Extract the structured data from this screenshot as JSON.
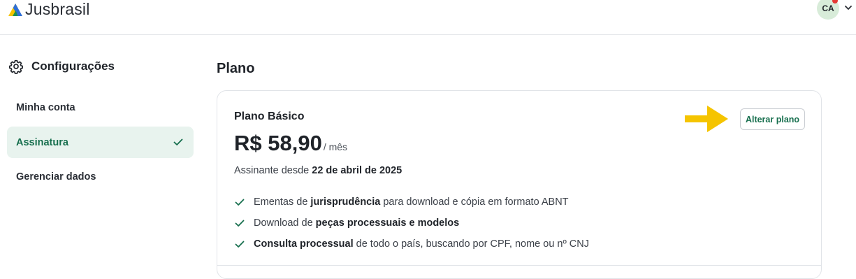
{
  "header": {
    "brand": "Jusbrasil",
    "user_initials": "CA",
    "brand_colors": {
      "yellow": "#f5c400",
      "green": "#1d8f4e",
      "blue": "#2f6fd6"
    }
  },
  "sidebar": {
    "title": "Configurações",
    "items": [
      {
        "label": "Minha conta",
        "active": false
      },
      {
        "label": "Assinatura",
        "active": true
      },
      {
        "label": "Gerenciar dados",
        "active": false
      }
    ]
  },
  "main": {
    "title": "Plano",
    "plan": {
      "name": "Plano Básico",
      "price": "R$ 58,90",
      "period": "/ mês",
      "since_label": "Assinante desde ",
      "since_date": "22 de abril de 2025",
      "change_button": "Alterar plano",
      "features": [
        {
          "pre": "Ementas de ",
          "bold": "jurisprudência",
          "post": " para download e cópia em formato ABNT"
        },
        {
          "pre": "Download de ",
          "bold": "peças processuais e modelos",
          "post": ""
        },
        {
          "pre": "",
          "bold": "Consulta processual",
          "post": " de todo o país, buscando por CPF, nome ou nº CNJ"
        }
      ]
    }
  },
  "colors": {
    "accent": "#176f4e",
    "active_bg": "#e8f3ee",
    "annotation_arrow": "#f5c400",
    "notification": "#e53935"
  }
}
